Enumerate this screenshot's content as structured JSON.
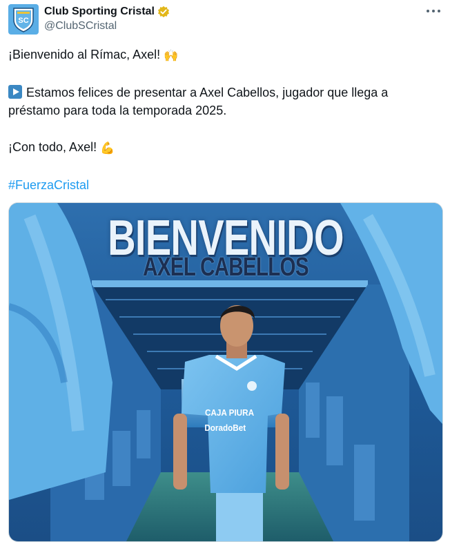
{
  "author": {
    "display_name": "Club Sporting Cristal",
    "handle": "@ClubSCristal",
    "avatar_text": "SC"
  },
  "tweet": {
    "line1": "¡Bienvenido al Rímac, Axel!",
    "line1_emoji": "🙌",
    "line2": "Estamos felices de presentar a Axel Cabellos, jugador que llega a préstamo para toda la temporada 2025.",
    "line3": "¡Con todo, Axel!",
    "line3_emoji": "💪",
    "hashtag": "#FuerzaCristal"
  },
  "media": {
    "headline": "BIENVENIDO",
    "player_name": "AXEL CABELLOS",
    "sponsor1": "CAJA PIURA",
    "sponsor2": "DoradoBet"
  },
  "colors": {
    "brand": "#5aaee6",
    "link": "#1d9bf0",
    "verified": "#e2b719"
  }
}
